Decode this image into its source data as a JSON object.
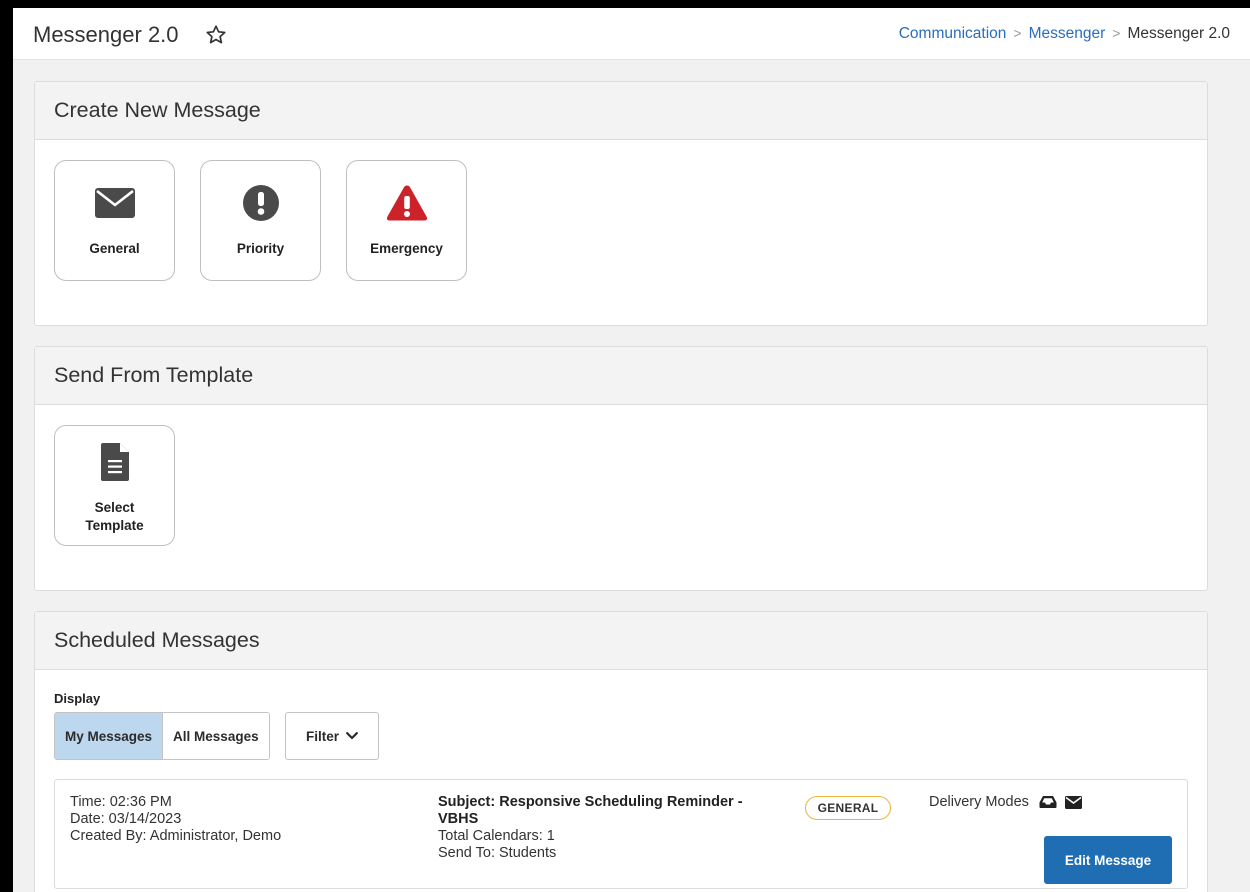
{
  "header": {
    "title": "Messenger 2.0",
    "breadcrumb": [
      "Communication",
      "Messenger",
      "Messenger 2.0"
    ]
  },
  "create_panel": {
    "title": "Create New Message",
    "tiles": [
      {
        "label": "General",
        "icon": "envelope-icon"
      },
      {
        "label": "Priority",
        "icon": "exclamation-circle-icon"
      },
      {
        "label": "Emergency",
        "icon": "warning-triangle-icon"
      }
    ]
  },
  "template_panel": {
    "title": "Send From Template",
    "tile": {
      "label_line1": "Select",
      "label_line2": "Template",
      "icon": "document-icon"
    }
  },
  "scheduled_panel": {
    "title": "Scheduled Messages",
    "display_label": "Display",
    "segments": [
      "My Messages",
      "All Messages"
    ],
    "active_segment": "My Messages",
    "filter_label": "Filter",
    "message": {
      "time": "Time: 02:36 PM",
      "date": "Date: 03/14/2023",
      "created_by": "Created By: Administrator, Demo",
      "subject_line1": "Subject: Responsive Scheduling Reminder -",
      "subject_line2": "VBHS",
      "total_calendars": "Total Calendars: 1",
      "send_to": "Send To: Students",
      "badge": "GENERAL",
      "delivery_label": "Delivery Modes",
      "delivery_icons": [
        "inbox-icon",
        "envelope-icon"
      ],
      "edit_label": "Edit Message"
    }
  },
  "colors": {
    "accent": "#1f6db3",
    "link": "#2a6dbd",
    "emergency": "#cc2229",
    "badge_border": "#e8b53a",
    "active_segment": "#bdd7ee",
    "icon_gray": "#4a4a4a"
  }
}
